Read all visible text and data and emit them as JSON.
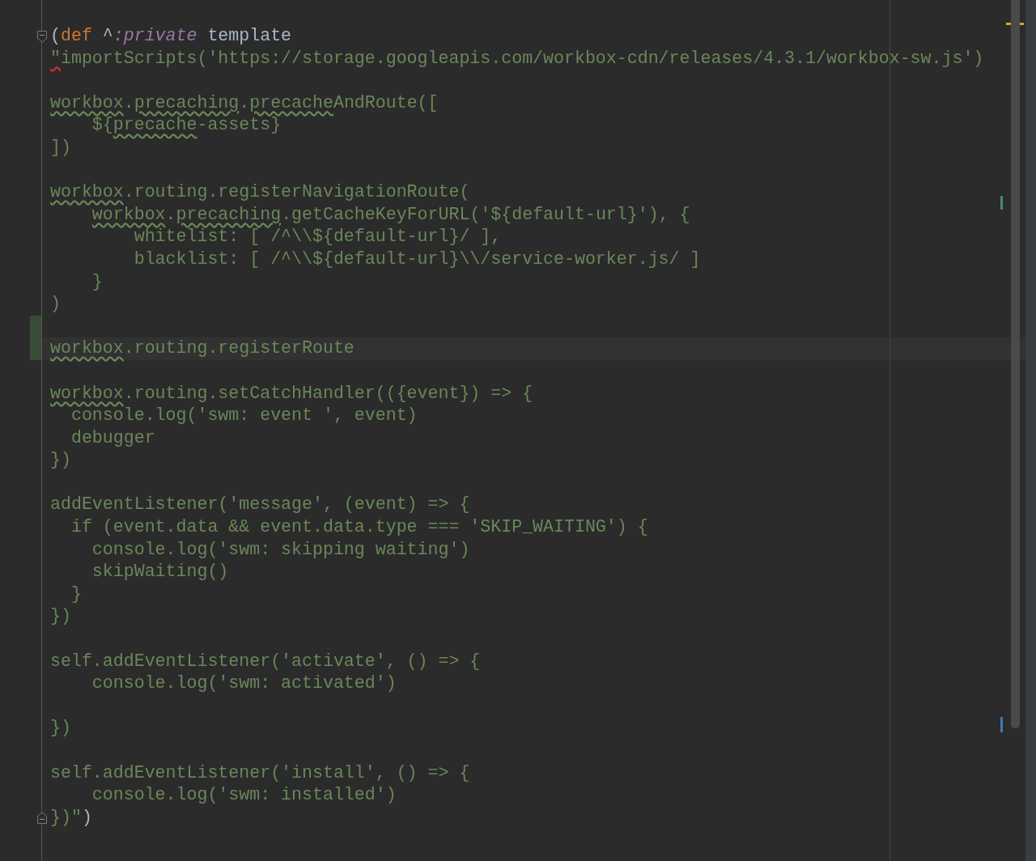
{
  "editor": {
    "lines": [
      {
        "kind": "code",
        "fold_start": true,
        "tokens": [
          {
            "text": "(",
            "kind": "plain"
          },
          {
            "text": "def",
            "kind": "keyword"
          },
          {
            "text": " ^",
            "kind": "plain"
          },
          {
            "text": ":private",
            "kind": "meta"
          },
          {
            "text": " template",
            "kind": "plain"
          }
        ]
      },
      {
        "kind": "code",
        "tokens": [
          {
            "text": "\"",
            "kind": "string",
            "error": true
          },
          {
            "text": "importScripts('https://storage.googleapis.com/workbox-cdn/releases/4.3.1/workbox-sw.js')",
            "kind": "string"
          }
        ]
      },
      {
        "kind": "blank"
      },
      {
        "kind": "code",
        "tokens": [
          {
            "text": "workbox",
            "kind": "string",
            "misspelled": true
          },
          {
            "text": ".",
            "kind": "string"
          },
          {
            "text": "precaching",
            "kind": "string",
            "misspelled": true
          },
          {
            "text": ".",
            "kind": "string"
          },
          {
            "text": "precache",
            "kind": "string",
            "misspelled": true
          },
          {
            "text": "AndRoute([",
            "kind": "string"
          }
        ]
      },
      {
        "kind": "code",
        "tokens": [
          {
            "text": "    ${",
            "kind": "string"
          },
          {
            "text": "precache",
            "kind": "string",
            "misspelled": true
          },
          {
            "text": "-assets}",
            "kind": "string"
          }
        ]
      },
      {
        "kind": "code",
        "tokens": [
          {
            "text": "])",
            "kind": "string"
          }
        ]
      },
      {
        "kind": "blank"
      },
      {
        "kind": "code",
        "tokens": [
          {
            "text": "workbox",
            "kind": "string",
            "misspelled": true
          },
          {
            "text": ".routing.registerNavigationRoute(",
            "kind": "string"
          }
        ]
      },
      {
        "kind": "code",
        "tokens": [
          {
            "text": "    workbox",
            "kind": "string",
            "misspelled": true
          },
          {
            "text": ".",
            "kind": "string"
          },
          {
            "text": "precaching",
            "kind": "string",
            "misspelled": true
          },
          {
            "text": ".getCacheKeyForURL('${default-url}'), {",
            "kind": "string"
          }
        ]
      },
      {
        "kind": "code",
        "tokens": [
          {
            "text": "        whitelist: [ /^\\\\${default-url}/ ],",
            "kind": "string"
          }
        ]
      },
      {
        "kind": "code",
        "tokens": [
          {
            "text": "        blacklist: [ /^\\\\${default-url}\\\\/service-worker.js/ ]",
            "kind": "string"
          }
        ]
      },
      {
        "kind": "code",
        "tokens": [
          {
            "text": "    }",
            "kind": "string"
          }
        ]
      },
      {
        "kind": "code",
        "tokens": [
          {
            "text": ")",
            "kind": "string"
          }
        ]
      },
      {
        "kind": "blank",
        "changed": true
      },
      {
        "kind": "code",
        "changed": true,
        "current": true,
        "tokens": [
          {
            "text": "workbox",
            "kind": "string",
            "misspelled": true
          },
          {
            "text": ".routing.registerRoute",
            "kind": "string"
          }
        ]
      },
      {
        "kind": "blank"
      },
      {
        "kind": "code",
        "tokens": [
          {
            "text": "workbox",
            "kind": "string",
            "misspelled": true
          },
          {
            "text": ".routing.setCatchHandler(({event}) => {",
            "kind": "string"
          }
        ]
      },
      {
        "kind": "code",
        "tokens": [
          {
            "text": "  console.log('swm: event ', event)",
            "kind": "string"
          }
        ]
      },
      {
        "kind": "code",
        "tokens": [
          {
            "text": "  debugger",
            "kind": "string"
          }
        ]
      },
      {
        "kind": "code",
        "tokens": [
          {
            "text": "})",
            "kind": "string"
          }
        ]
      },
      {
        "kind": "blank"
      },
      {
        "kind": "code",
        "tokens": [
          {
            "text": "addEventListener('message', (event) => {",
            "kind": "string"
          }
        ]
      },
      {
        "kind": "code",
        "tokens": [
          {
            "text": "  if (event.data && event.data.type === 'SKIP_WAITING') {",
            "kind": "string"
          }
        ]
      },
      {
        "kind": "code",
        "tokens": [
          {
            "text": "    console.log('swm: skipping waiting')",
            "kind": "string"
          }
        ]
      },
      {
        "kind": "code",
        "tokens": [
          {
            "text": "    skipWaiting()",
            "kind": "string"
          }
        ]
      },
      {
        "kind": "code",
        "tokens": [
          {
            "text": "  }",
            "kind": "string"
          }
        ]
      },
      {
        "kind": "code",
        "tokens": [
          {
            "text": "})",
            "kind": "string"
          }
        ]
      },
      {
        "kind": "blank"
      },
      {
        "kind": "code",
        "tokens": [
          {
            "text": "self.addEventListener('activate', () => {",
            "kind": "string"
          }
        ]
      },
      {
        "kind": "code",
        "tokens": [
          {
            "text": "    console.log('swm: activated')",
            "kind": "string"
          }
        ]
      },
      {
        "kind": "blank"
      },
      {
        "kind": "code",
        "tokens": [
          {
            "text": "})",
            "kind": "string"
          }
        ]
      },
      {
        "kind": "blank"
      },
      {
        "kind": "code",
        "tokens": [
          {
            "text": "self.addEventListener('install', () => {",
            "kind": "string"
          }
        ]
      },
      {
        "kind": "code",
        "tokens": [
          {
            "text": "    console.log('swm: installed')",
            "kind": "string"
          }
        ]
      },
      {
        "kind": "code",
        "fold_end": true,
        "tokens": [
          {
            "text": "})\"",
            "kind": "string"
          },
          {
            "text": ")",
            "kind": "plain"
          }
        ]
      }
    ]
  }
}
